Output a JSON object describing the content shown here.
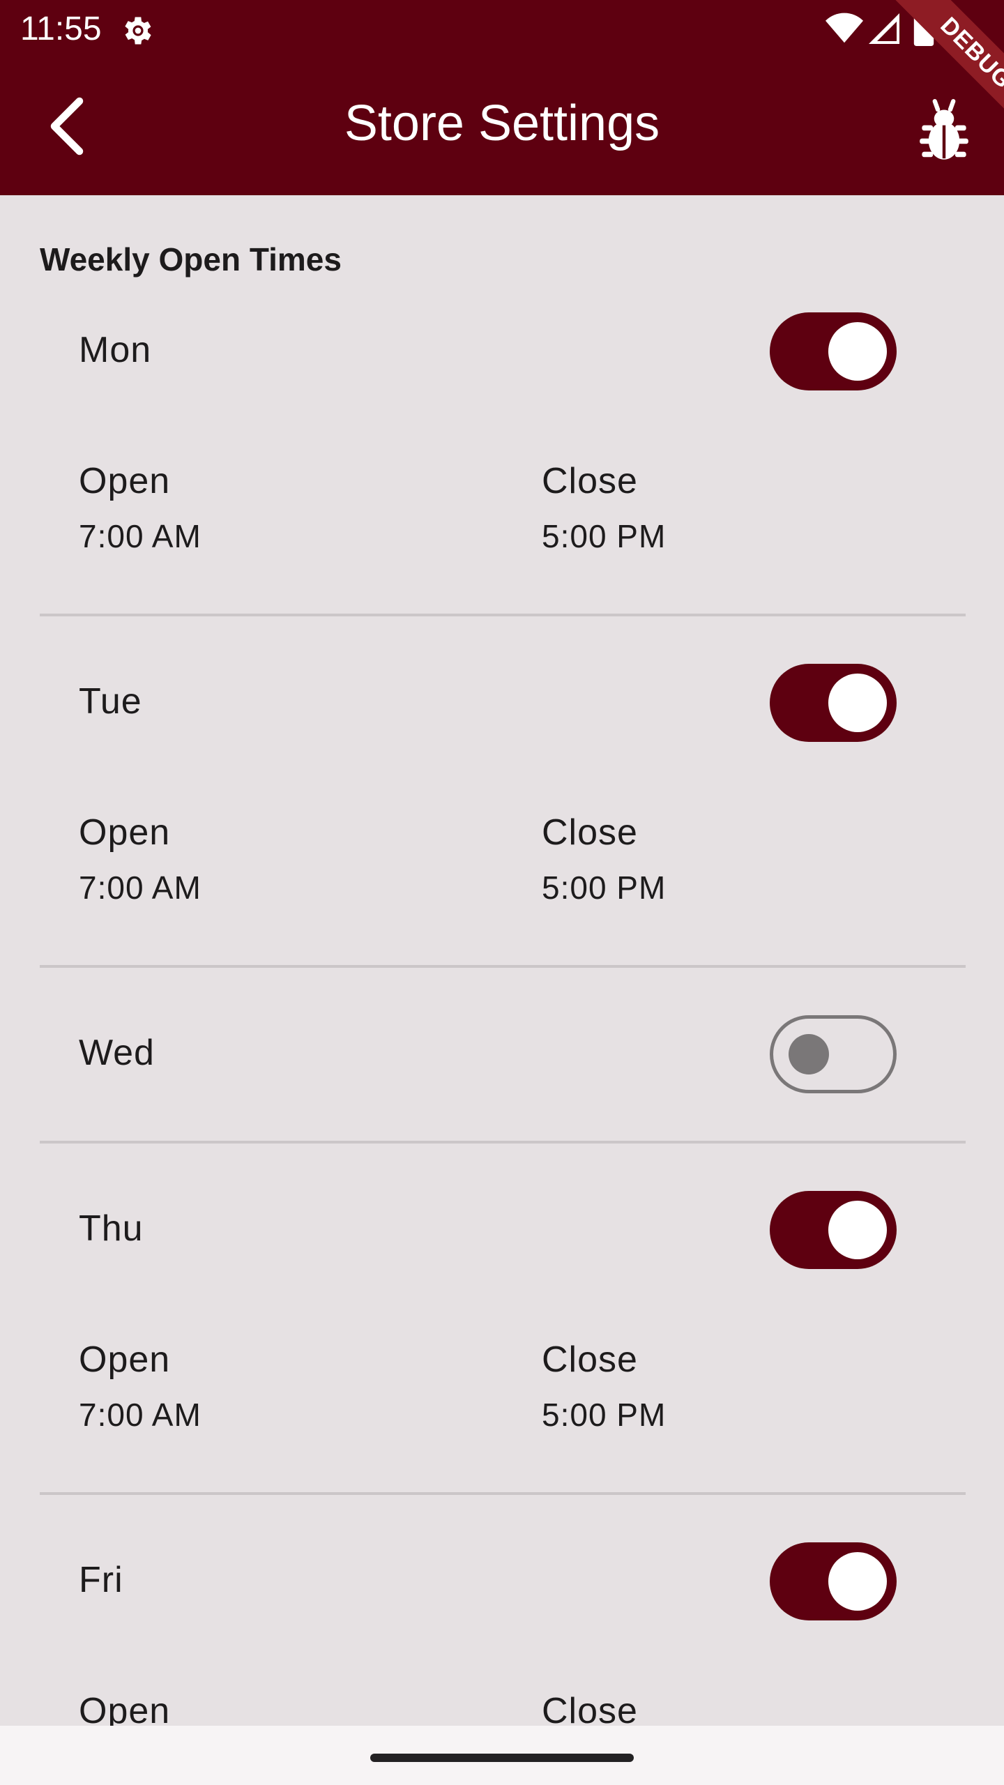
{
  "status_bar": {
    "time": "11:55"
  },
  "app_bar": {
    "title": "Store Settings",
    "debug_label": "DEBUG"
  },
  "section": {
    "title": "Weekly Open Times"
  },
  "days": [
    {
      "name": "Mon",
      "enabled": true,
      "open_label": "Open",
      "open_time": "7:00 AM",
      "close_label": "Close",
      "close_time": "5:00 PM"
    },
    {
      "name": "Tue",
      "enabled": true,
      "open_label": "Open",
      "open_time": "7:00 AM",
      "close_label": "Close",
      "close_time": "5:00 PM"
    },
    {
      "name": "Wed",
      "enabled": false
    },
    {
      "name": "Thu",
      "enabled": true,
      "open_label": "Open",
      "open_time": "7:00 AM",
      "close_label": "Close",
      "close_time": "5:00 PM"
    },
    {
      "name": "Fri",
      "enabled": true,
      "open_label": "Open",
      "close_label": "Close"
    }
  ],
  "colors": {
    "primary": "#5e0010",
    "background": "#e6e1e3",
    "toggle_off": "#7a7778"
  }
}
